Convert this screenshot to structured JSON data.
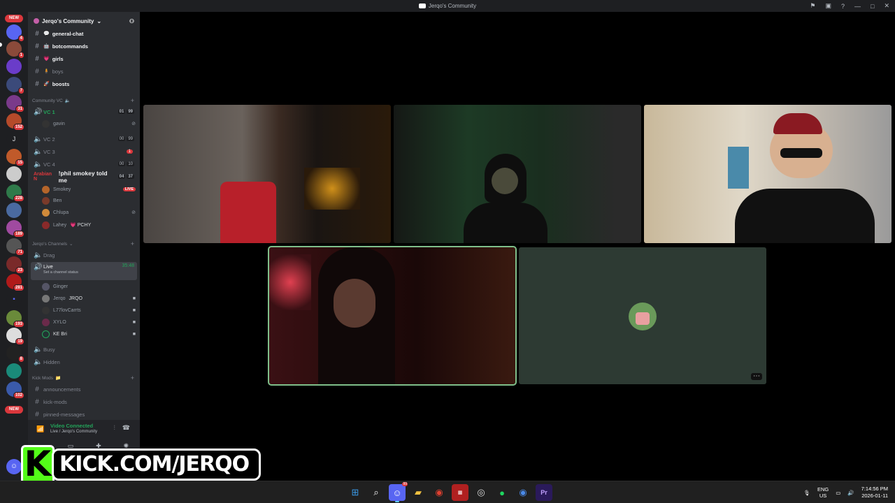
{
  "window": {
    "title": "Jerqo's Community"
  },
  "rail": {
    "new_badge": "NEW",
    "badges": [
      "4",
      "1",
      "7",
      "31",
      "152",
      "J",
      "15",
      "228",
      "189",
      "71",
      "23",
      "281",
      "193",
      "19",
      "8",
      "102"
    ],
    "new_badge_bottom": "NEW"
  },
  "server": {
    "name": "Jerqo's Community"
  },
  "text_channels": [
    {
      "name": "general-chat",
      "emoji": "💬"
    },
    {
      "name": "botcommands",
      "emoji": "🤖"
    },
    {
      "name": "girls",
      "emoji": "💗"
    },
    {
      "name": "boys",
      "emoji": "🧍"
    },
    {
      "name": "boosts",
      "emoji": "🚀"
    }
  ],
  "categories": {
    "community_vc": "Community VC",
    "jerqos_channels": "Jerqo's Channels",
    "kick_mods": "Kick Mods"
  },
  "voice_channels": {
    "vc1": {
      "name": "VC 1",
      "count": "01",
      "limit": "99",
      "user": "gavin"
    },
    "vc2": {
      "name": "VC 2",
      "count": "00",
      "limit": "99"
    },
    "vc3": {
      "name": "VC 3",
      "badge": "1"
    },
    "vc4": {
      "name": "VC 4",
      "count": "00",
      "limit": "10"
    },
    "phil": {
      "name": "!phil smokey told me",
      "count": "04",
      "limit": "37",
      "prefix": "Arabian N"
    },
    "phil_users": [
      {
        "name": "Smokey",
        "live": "LIVE"
      },
      {
        "name": "Ben"
      },
      {
        "name": "Chlupa"
      },
      {
        "name": "Lahey",
        "extra": "💗 PCHY"
      }
    ]
  },
  "jerqo_channels": {
    "drag": "Drag",
    "live": {
      "name": "Live",
      "time": "35:48",
      "status": "Set a channel status"
    },
    "live_users": [
      "Ginger",
      "Jerqo",
      "L77lovCarrts",
      "XYLO",
      "KE Bri"
    ],
    "jerqo_tag": "JRQO",
    "busy": "Busy",
    "hidden": "Hidden"
  },
  "kick_channels": [
    "announcements",
    "kick-mods",
    "pinned-messages"
  ],
  "voice_panel": {
    "status": "Video Connected",
    "location": "Live / Jerqo's Community"
  },
  "overlay": {
    "k": "K",
    "url": "KICK.COM/JERQO"
  },
  "taskbar": {
    "lang_top": "ENG",
    "lang_bottom": "US",
    "time": "7:14:56 PM",
    "date": "2026-01-11",
    "discord_badge": "99"
  },
  "colors": {
    "speaking": "#7fbf8a",
    "kick_green": "#53fc18",
    "online": "#23a55a",
    "danger": "#da373c"
  }
}
